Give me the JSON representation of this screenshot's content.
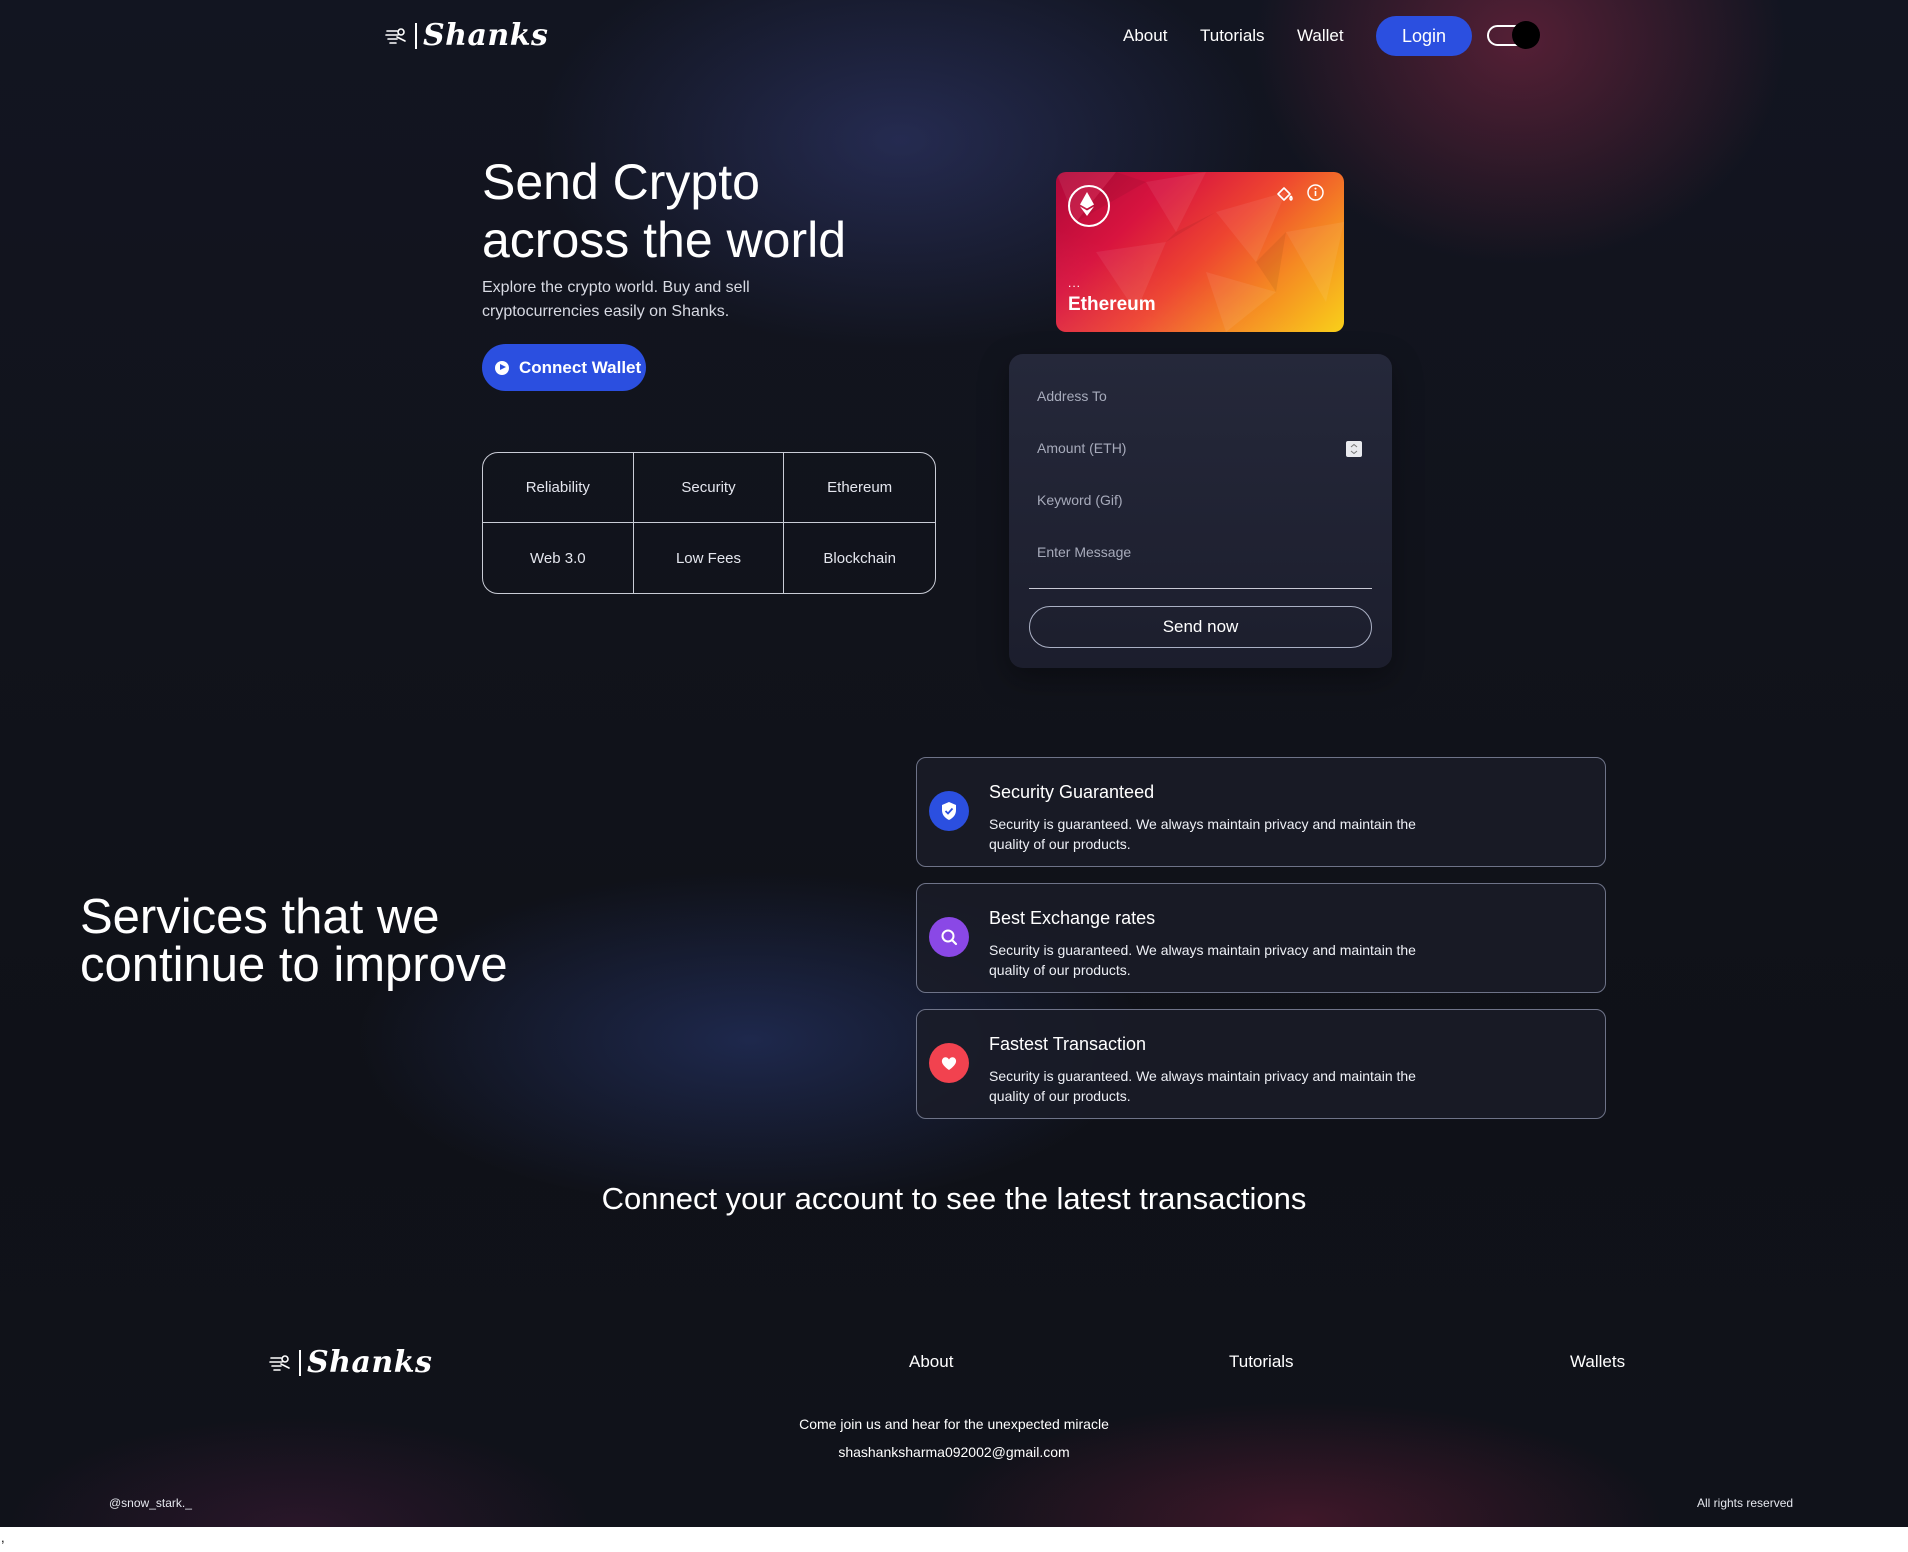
{
  "brand": {
    "name": "Shanks"
  },
  "nav": {
    "links": [
      "About",
      "Tutorials",
      "Wallet"
    ],
    "login_label": "Login"
  },
  "hero": {
    "title_line1": "Send Crypto",
    "title_line2": "across the world",
    "subtitle_line1": "Explore the crypto world. Buy and sell",
    "subtitle_line2": "cryptocurrencies easily on Shanks.",
    "connect_label": "Connect Wallet",
    "features": [
      "Reliability",
      "Security",
      "Ethereum",
      "Web 3.0",
      "Low Fees",
      "Blockchain"
    ]
  },
  "eth_card": {
    "name": "Ethereum",
    "address_dots": "...",
    "icons": [
      "ethereum-icon",
      "paint-bucket-icon",
      "info-icon"
    ],
    "gradient_colors": [
      "#b0083a",
      "#ee4530",
      "#f9d01a"
    ]
  },
  "form": {
    "address_placeholder": "Address To",
    "amount_placeholder": "Amount (ETH)",
    "keyword_placeholder": "Keyword (Gif)",
    "message_placeholder": "Enter Message",
    "send_label": "Send now"
  },
  "services": {
    "title_line1": "Services that we",
    "title_line2": "continue to improve",
    "items": [
      {
        "title": "Security Guaranteed",
        "desc_line1": "Security is guaranteed. We always maintain privacy and maintain the",
        "desc_line2": "quality of our products.",
        "icon": "shield-check-icon",
        "color": "#2b4fe0"
      },
      {
        "title": "Best Exchange rates",
        "desc_line1": "Security is guaranteed. We always maintain privacy and maintain the",
        "desc_line2": "quality of our products.",
        "icon": "search-icon",
        "color": "#8a48e6"
      },
      {
        "title": "Fastest Transaction",
        "desc_line1": "Security is guaranteed. We always maintain privacy and maintain the",
        "desc_line2": "quality of our products.",
        "icon": "heart-icon",
        "color": "#f2424f"
      }
    ]
  },
  "transactions": {
    "message": "Connect your account to see the latest transactions"
  },
  "footer": {
    "links": [
      "About",
      "Tutorials",
      "Wallets"
    ],
    "tagline": "Come join us and hear for the unexpected miracle",
    "email": "shashanksharma092002@gmail.com",
    "handle": "@snow_stark._",
    "rights": "All rights reserved"
  },
  "stray_char": ","
}
